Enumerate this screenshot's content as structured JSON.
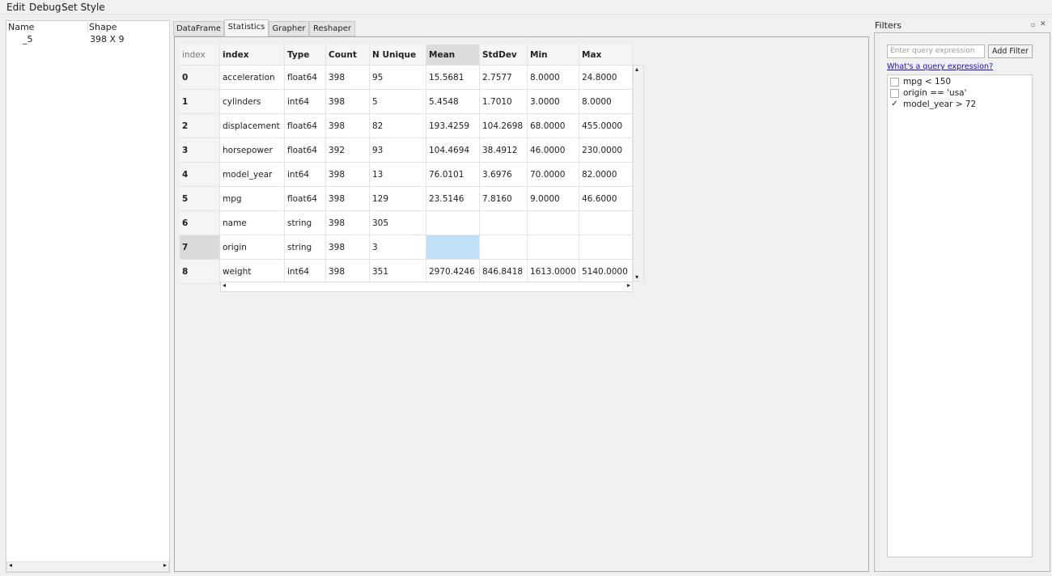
{
  "menu": [
    "Edit",
    "Debug",
    "Set Style"
  ],
  "left_panel": {
    "headers": [
      "Name",
      "Shape"
    ],
    "rows": [
      {
        "name": "_5",
        "shape": "398 X 9"
      }
    ]
  },
  "tabs": [
    {
      "label": "DataFrame"
    },
    {
      "label": "Statistics",
      "active": true
    },
    {
      "label": "Grapher"
    },
    {
      "label": "Reshaper"
    }
  ],
  "table": {
    "columns": [
      "index",
      "index",
      "Type",
      "Count",
      "N Unique",
      "Mean",
      "StdDev",
      "Min",
      "Max"
    ],
    "rows": [
      [
        "0",
        "acceleration",
        "float64",
        "398",
        "95",
        "15.5681",
        "2.7577",
        "8.0000",
        "24.8000"
      ],
      [
        "1",
        "cylinders",
        "int64",
        "398",
        "5",
        "5.4548",
        "1.7010",
        "3.0000",
        "8.0000"
      ],
      [
        "2",
        "displacement",
        "float64",
        "398",
        "82",
        "193.4259",
        "104.2698",
        "68.0000",
        "455.0000"
      ],
      [
        "3",
        "horsepower",
        "float64",
        "392",
        "93",
        "104.4694",
        "38.4912",
        "46.0000",
        "230.0000"
      ],
      [
        "4",
        "model_year",
        "int64",
        "398",
        "13",
        "76.0101",
        "3.6976",
        "70.0000",
        "82.0000"
      ],
      [
        "5",
        "mpg",
        "float64",
        "398",
        "129",
        "23.5146",
        "7.8160",
        "9.0000",
        "46.6000"
      ],
      [
        "6",
        "name",
        "string",
        "398",
        "305",
        "",
        "",
        "",
        ""
      ],
      [
        "7",
        "origin",
        "string",
        "398",
        "3",
        "",
        "",
        "",
        ""
      ],
      [
        "8",
        "weight",
        "int64",
        "398",
        "351",
        "2970.4246",
        "846.8418",
        "1613.0000",
        "5140.0000"
      ]
    ],
    "selected": {
      "row": 7,
      "column": "Mean"
    },
    "selection_color": "#bfe0f7"
  },
  "filters": {
    "title": "Filters",
    "query_placeholder": "Enter query expression",
    "add_button": "Add Filter",
    "help_link": "What's a query expression?",
    "items": [
      {
        "label": "mpg < 150",
        "checked": false
      },
      {
        "label": "origin == 'usa'",
        "checked": false
      },
      {
        "label": "model_year > 72",
        "checked": true
      }
    ]
  }
}
